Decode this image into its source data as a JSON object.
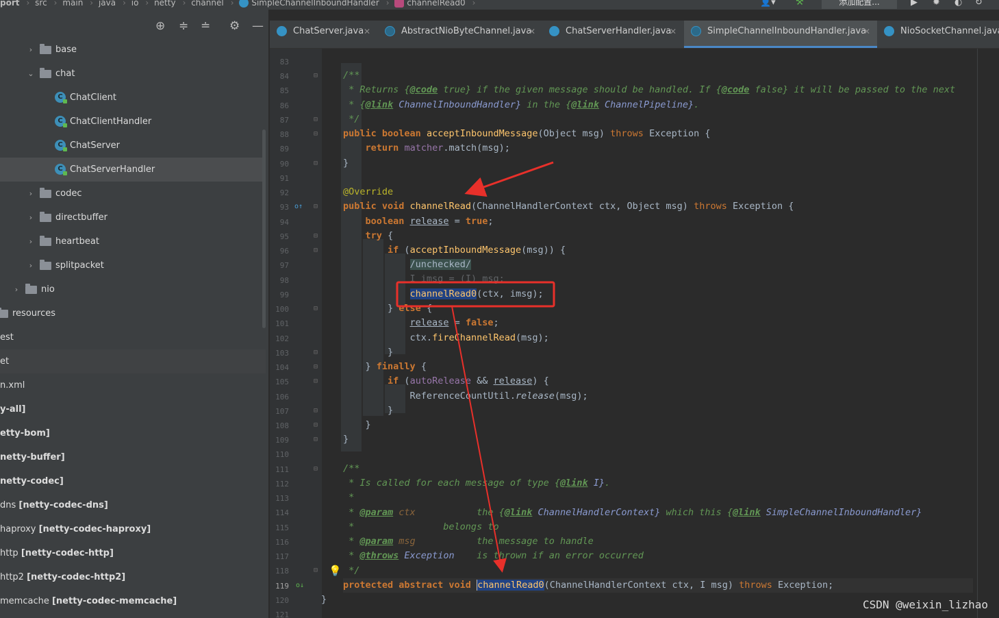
{
  "breadcrumbs": [
    "port",
    "src",
    "main",
    "java",
    "io",
    "netty",
    "channel",
    "SimpleChannelInboundHandler",
    "channelRead0"
  ],
  "toolbar": {
    "add_config_label": "添加配置..."
  },
  "project_tree": [
    {
      "label": "base",
      "type": "folder",
      "expanded": false
    },
    {
      "label": "chat",
      "type": "folder",
      "expanded": true
    },
    {
      "label": "ChatClient",
      "type": "class"
    },
    {
      "label": "ChatClientHandler",
      "type": "class"
    },
    {
      "label": "ChatServer",
      "type": "class"
    },
    {
      "label": "ChatServerHandler",
      "type": "class",
      "selected": true
    },
    {
      "label": "codec",
      "type": "folder",
      "expanded": false
    },
    {
      "label": "directbuffer",
      "type": "folder",
      "expanded": false
    },
    {
      "label": "heartbeat",
      "type": "folder",
      "expanded": false
    },
    {
      "label": "splitpacket",
      "type": "folder",
      "expanded": false
    },
    {
      "label": "nio",
      "type": "folder",
      "expanded": false
    },
    {
      "label": "resources",
      "type": "folder"
    },
    {
      "label": "est",
      "type": "text"
    },
    {
      "label": "et",
      "type": "text"
    },
    {
      "label": "n.xml",
      "type": "text"
    },
    {
      "label": "y-all]",
      "type": "lib"
    },
    {
      "label": "etty-bom]",
      "type": "lib"
    },
    {
      "label": "netty-buffer]",
      "type": "lib"
    },
    {
      "label": "netty-codec]",
      "type": "lib"
    },
    {
      "label": "dns ",
      "bold": "[netty-codec-dns]",
      "type": "lib"
    },
    {
      "label": "haproxy ",
      "bold": "[netty-codec-haproxy]",
      "type": "lib"
    },
    {
      "label": "http ",
      "bold": "[netty-codec-http]",
      "type": "lib"
    },
    {
      "label": "http2 ",
      "bold": "[netty-codec-http2]",
      "type": "lib"
    },
    {
      "label": "memcache ",
      "bold": "[netty-codec-memcache]",
      "type": "lib"
    }
  ],
  "tabs": [
    {
      "label": "ChatServer.java",
      "active": false
    },
    {
      "label": "AbstractNioByteChannel.java",
      "active": false
    },
    {
      "label": "ChatServerHandler.java",
      "active": false
    },
    {
      "label": "SimpleChannelInboundHandler.java",
      "active": true
    },
    {
      "label": "NioSocketChannel.java",
      "active": false
    }
  ],
  "line_numbers": [
    "83",
    "84",
    "85",
    "86",
    "87",
    "88",
    "89",
    "90",
    "91",
    "92",
    "93",
    "94",
    "95",
    "96",
    "97",
    "98",
    "99",
    "100",
    "101",
    "102",
    "103",
    "104",
    "105",
    "106",
    "107",
    "108",
    "109",
    "110",
    "111",
    "112",
    "113",
    "114",
    "115",
    "116",
    "117",
    "118",
    "119",
    "120",
    "121"
  ],
  "code": {
    "l84": "/**",
    "l85_pre": " * Returns ",
    "l85_tag1": "@code",
    "l85_mid1": " true}",
    "l85_mid2": " if the given message should be handled. If ",
    "l85_tag2": "@code",
    "l85_mid3": " false}",
    "l85_post": " it will be passed to the next",
    "l86_pre": " * ",
    "l86_tag1": "@link",
    "l86_ref1": " ChannelInboundHandler}",
    "l86_mid": " in the ",
    "l86_tag2": "@link",
    "l86_ref2": " ChannelPipeline}",
    "l86_post": ".",
    "l87": " */",
    "l88_kw": "public boolean",
    "l88_fn": "acceptInboundMessage",
    "l88_args": "(Object msg) ",
    "l88_throws": "throws",
    "l88_post": " Exception {",
    "l89_kw": "return",
    "l89_fld": "matcher",
    "l89_post": ".match(msg);",
    "l90": "}",
    "l92": "@Override",
    "l93_kw": "public void",
    "l93_fn": "channelRead",
    "l93_args": "(ChannelHandlerContext ctx, Object msg) ",
    "l93_throws": "throws",
    "l93_post": " Exception {",
    "l94_kw": "boolean",
    "l94_var": "release",
    "l94_eq": " = ",
    "l94_val": "true",
    "l94_post": ";",
    "l95_kw": "try",
    "l95_post": " {",
    "l96_kw": "if",
    "l96_fn": "acceptInboundMessage",
    "l96_post": "(msg)) {",
    "l97": "/unchecked/",
    "l98": "I imsg = (I) msg;",
    "l99_fn": "channelRead0",
    "l99_post": "(ctx, imsg);",
    "l100_pre": "} ",
    "l100_kw": "else",
    "l100_post": " {",
    "l101_var": "release",
    "l101_eq": " = ",
    "l101_val": "false",
    "l101_post": ";",
    "l102_pre": "ctx.",
    "l102_fn": "fireChannelRead",
    "l102_post": "(msg);",
    "l103": "}",
    "l104_pre": "} ",
    "l104_kw": "finally",
    "l104_post": " {",
    "l105_kw": "if",
    "l105_fld": "autoRelease",
    "l105_mid": " && ",
    "l105_var": "release",
    "l105_post": ") {",
    "l106_cls": "ReferenceCountUtil.",
    "l106_fn": "release",
    "l106_post": "(msg);",
    "l107": "}",
    "l108": "}",
    "l109": "}",
    "l111": "/**",
    "l112_pre": " * Is called for each message of type ",
    "l112_tag": "@link",
    "l112_ref": " I}",
    "l112_post": ".",
    "l113": " *",
    "l114_pre": " * ",
    "l114_tag": "@param",
    "l114_name": " ctx",
    "l114_desc": "the ",
    "l114_tag2": "@link",
    "l114_ref": " ChannelHandlerContext}",
    "l114_mid": " which this ",
    "l114_tag3": "@link",
    "l114_ref2": " SimpleChannelInboundHandler}",
    "l115": " *                belongs to",
    "l116_pre": " * ",
    "l116_tag": "@param",
    "l116_name": " msg",
    "l116_desc": "the message to handle",
    "l117_pre": " * ",
    "l117_tag": "@throws",
    "l117_name": " Exception",
    "l117_desc": "is thrown if an error occurred",
    "l118": " */",
    "l119_kw": "protected abstract void",
    "l119_fn": "channelRead0",
    "l119_args": "(ChannelHandlerContext ctx, I msg) ",
    "l119_throws": "throws",
    "l119_post": " Exception;",
    "l120": "}"
  },
  "watermark": "CSDN @weixin_lizhao",
  "colors": {
    "accent": "#4a88c7",
    "annotation_red": "#e8302a"
  }
}
